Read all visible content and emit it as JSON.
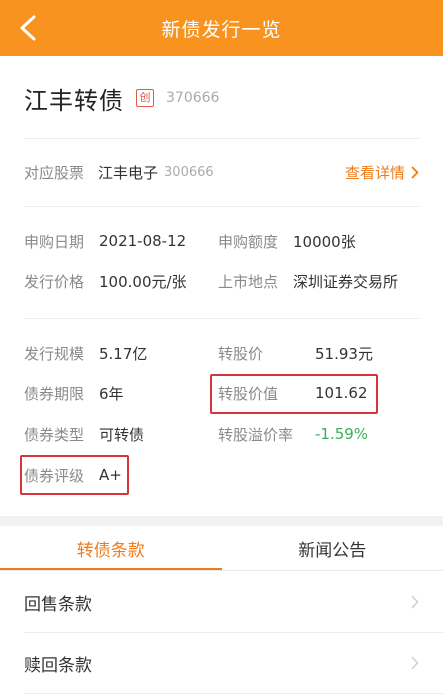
{
  "header": {
    "title": "新债发行一览"
  },
  "bond": {
    "name": "江丰转债",
    "badge": "创",
    "code": "370666"
  },
  "stock": {
    "label": "对应股票",
    "name": "江丰电子",
    "code": "300666",
    "detail_link": "查看详情"
  },
  "info1": {
    "subscribe_date_label": "申购日期",
    "subscribe_date": "2021-08-12",
    "subscribe_amount_label": "申购额度",
    "subscribe_amount": "10000张",
    "issue_price_label": "发行价格",
    "issue_price": "100.00元/张",
    "listing_place_label": "上市地点",
    "listing_place": "深圳证券交易所"
  },
  "info2": {
    "issue_size_label": "发行规模",
    "issue_size": "5.17亿",
    "conversion_price_label": "转股价",
    "conversion_price": "51.93元",
    "term_label": "债券期限",
    "term": "6年",
    "conversion_value_label": "转股价值",
    "conversion_value": "101.62",
    "bond_type_label": "债券类型",
    "bond_type": "可转债",
    "premium_label": "转股溢价率",
    "premium": "-1.59%",
    "rating_label": "债券评级",
    "rating": "A+"
  },
  "tabs": [
    {
      "label": "转债条款"
    },
    {
      "label": "新闻公告"
    }
  ],
  "list": [
    {
      "label": "回售条款"
    },
    {
      "label": "赎回条款"
    }
  ],
  "colors": {
    "accent": "#f7931e",
    "highlight": "#d8343b",
    "negative": "#3cae5a"
  }
}
